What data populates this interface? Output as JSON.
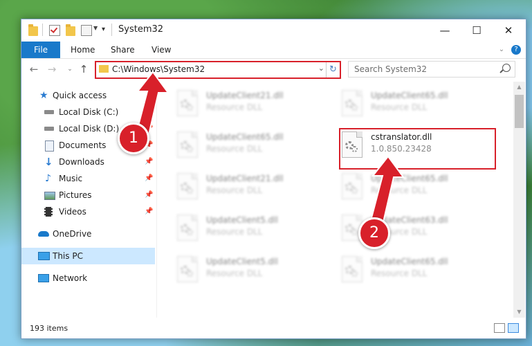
{
  "window": {
    "title": "System32",
    "controls": {
      "minimize": "—",
      "maximize": "☐",
      "close": "✕"
    }
  },
  "ribbon": {
    "file_label": "File",
    "tabs": [
      "Home",
      "Share",
      "View"
    ],
    "expand_icon": "chevron-down-icon",
    "help_icon": "help-icon"
  },
  "address": {
    "path": "C:\\Windows\\System32",
    "search_placeholder": "Search System32"
  },
  "nav_pane": {
    "items": [
      {
        "label": "Quick access",
        "icon": "star-icon"
      },
      {
        "label": "Local Disk (C:)",
        "icon": "drive-icon",
        "pinned": true
      },
      {
        "label": "Local Disk (D:)",
        "icon": "drive-icon",
        "pinned": true
      },
      {
        "label": "Documents",
        "icon": "document-icon",
        "pinned": true
      },
      {
        "label": "Downloads",
        "icon": "download-icon",
        "pinned": true
      },
      {
        "label": "Music",
        "icon": "music-icon",
        "pinned": true
      },
      {
        "label": "Pictures",
        "icon": "pictures-icon",
        "pinned": true
      },
      {
        "label": "Videos",
        "icon": "video-icon",
        "pinned": true
      },
      {
        "label": "OneDrive",
        "icon": "cloud-icon"
      },
      {
        "label": "This PC",
        "icon": "computer-icon",
        "selected": true
      },
      {
        "label": "Network",
        "icon": "network-icon"
      }
    ]
  },
  "files": [
    {
      "name": "UpdateClient21.dll",
      "desc": "Resource DLL",
      "blurred": true
    },
    {
      "name": "UpdateClient65.dll",
      "desc": "Resource DLL",
      "blurred": true
    },
    {
      "name": "UpdateClient65.dll",
      "desc": "Resource DLL",
      "blurred": true
    },
    {
      "name": "cstranslator.dll",
      "desc": "1.0.850.23428",
      "blurred": false
    },
    {
      "name": "UpdateClient21.dll",
      "desc": "Resource DLL",
      "blurred": true
    },
    {
      "name": "UpdateClient65.dll",
      "desc": "Resource DLL",
      "blurred": true
    },
    {
      "name": "UpdateClient5.dll",
      "desc": "Resource DLL",
      "blurred": true
    },
    {
      "name": "UpdateClient63.dll",
      "desc": "Resource DLL",
      "blurred": true
    },
    {
      "name": "UpdateClient5.dll",
      "desc": "Resource DLL",
      "blurred": true
    },
    {
      "name": "UpdateClient65.dll",
      "desc": "Resource DLL",
      "blurred": true
    }
  ],
  "status": {
    "item_count": "193 items"
  },
  "annotations": {
    "step1": "1",
    "step2": "2"
  },
  "colors": {
    "accent": "#1979ca",
    "highlight": "#d8202a",
    "selection": "#cce8ff"
  }
}
